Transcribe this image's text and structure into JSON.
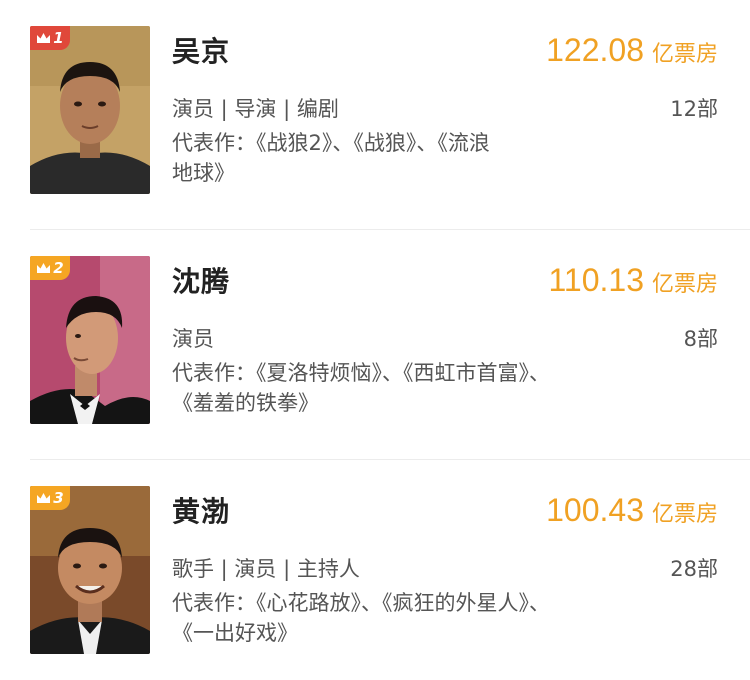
{
  "actors": [
    {
      "rank": "1",
      "name": "吴京",
      "box_office": "122.08",
      "box_unit": "亿票房",
      "roles": "演员 | 导演 | 编剧",
      "film_count": "12部",
      "works_line1": "代表作：《战狼2》、《战狼》、《流浪",
      "works_line2": "地球》",
      "badge_color": "#e0483a"
    },
    {
      "rank": "2",
      "name": "沈腾",
      "box_office": "110.13",
      "box_unit": "亿票房",
      "roles": "演员",
      "film_count": "8部",
      "works_line1": "代表作：《夏洛特烦恼》、《西虹市首富》、",
      "works_line2": "《羞羞的铁拳》",
      "badge_color": "#f5a623"
    },
    {
      "rank": "3",
      "name": "黄渤",
      "box_office": "100.43",
      "box_unit": "亿票房",
      "roles": "歌手 | 演员 | 主持人",
      "film_count": "28部",
      "works_line1": "代表作：《心花路放》、《疯狂的外星人》、",
      "works_line2": "《一出好戏》",
      "badge_color": "#f5a623"
    }
  ]
}
